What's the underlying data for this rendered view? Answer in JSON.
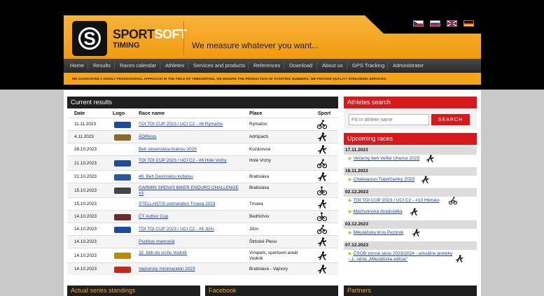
{
  "header": {
    "brand_main": "SPORT",
    "brand_soft": "SOFT",
    "brand_sub": "TIMING",
    "logo_letter": "S",
    "slogan": "We measure whatever you want..."
  },
  "flags": [
    "czech-flag-icon",
    "slovak-flag-icon",
    "uk-flag-icon",
    "german-flag-icon"
  ],
  "nav": [
    "Home",
    "Results",
    "Races calendar",
    "Athletes",
    "Services and products",
    "References",
    "Download",
    "About us",
    "GPS Tracking",
    "Administrator"
  ],
  "tagline": "WE GUARANTEE A HIGHLY PROFESSIONAL APPROACH IN THE FIELD OF TIMEKEEPING.    WE ENSURE THE PRODUCTION OF STARTING NUMBERS.    WE PROVIDE QUALITY STREAMING SERVICES.",
  "results": {
    "title": "Current results",
    "columns": [
      "Date",
      "Logo",
      "Race name",
      "Place",
      "Sport"
    ],
    "rows": [
      {
        "date": "11.11.2023",
        "name": "TOI TOI CUP 2023 / UCI C2 - #8 Rýmařov",
        "place": "Rýmařov",
        "sport": "cyclist-icon",
        "logo": "#1e4aa0"
      },
      {
        "date": "4.11.2023",
        "name": "ÁDRkros",
        "place": "Adršpach",
        "sport": "runner-icon",
        "logo": "#8a6a2a"
      },
      {
        "date": "28.10.2023",
        "name": "Beh slovenskou bránou 2023",
        "place": "Kozárovce",
        "sport": "runner-icon",
        "logo": ""
      },
      {
        "date": "21.10.2023",
        "name": "TOI TOI CUP 2023 / UCI C2 - #6 Holé Vrchy",
        "place": "Holé Vrchy",
        "sport": "cyclist-icon",
        "logo": "#1e4aa0"
      },
      {
        "date": "21.10.2023",
        "name": "48. Beh Devínskou kobylou",
        "place": "Bratislava",
        "sport": "runner-icon",
        "logo": "#2a5a9a"
      },
      {
        "date": "15.10.2023",
        "name": "GARMIN SPEN#3 BIKER ENDURO CHALLENGE #3",
        "place": "Bratislava",
        "sport": "bike-icon",
        "logo": "#444"
      },
      {
        "date": "15.10.2023",
        "name": "STELLANTIS polmaratón Trnava 2023",
        "place": "Trnava",
        "sport": "runner-icon",
        "logo": ""
      },
      {
        "date": "14.10.2023",
        "name": "ČT Author Cup",
        "place": "Bedřichov",
        "sport": "bike-icon",
        "logo": "#6a2a2a"
      },
      {
        "date": "14.10.2023",
        "name": "TOI TOI CUP 2023 / UCI C2 - #4 Jičín",
        "place": "Jičín",
        "sport": "cyclist-icon",
        "logo": "#1e4aa0"
      },
      {
        "date": "14.10.2023",
        "name": "Psoťkov memoriál",
        "place": "Štrbské Pleso",
        "sport": "runner-icon",
        "logo": ""
      },
      {
        "date": "14.10.2023",
        "name": "32. běh do vrchu Vodník",
        "place": "Vimperk, sportovní areál Vodník",
        "sport": "runner-icon",
        "logo": "#b88a10"
      },
      {
        "date": "14.10.2023",
        "name": "Vajnorský minimaratón 2023",
        "place": "Bratislava - Vajnory",
        "sport": "runner-icon",
        "logo": "#c8281a"
      }
    ]
  },
  "search": {
    "title": "Athletes search",
    "placeholder": "Fill in athlete name",
    "button": "SEARCH"
  },
  "upcoming": {
    "title": "Upcoming races",
    "groups": [
      {
        "date": "17.11.2023",
        "items": [
          {
            "name": "Večerný beh Veľké Uherce 2023",
            "sport": "runner-icon"
          }
        ]
      },
      {
        "date": "18.11.2023",
        "items": [
          {
            "name": "Chateaurun Topoľčianky 2023",
            "sport": "runner-icon"
          }
        ]
      },
      {
        "date": "02.12.2023",
        "items": [
          {
            "name": "TOI TOI CUP 2023 / UCI C2 - #10 Hlinsko",
            "sport": "cyclist-icon"
          },
          {
            "name": "Machulinská dvadsiatka",
            "sport": "runner-icon"
          }
        ]
      },
      {
        "date": "03.12.2023",
        "items": [
          {
            "name": "Mikulášsky kros Pezinok",
            "sport": "runner-icon"
          }
        ]
      },
      {
        "date": "07.12.2023",
        "items": [
          {
            "name": "ČSOB zimná séria 2023/2024 - virtuálne preteky - 1. séria „Mikulášska edícia\"",
            "sport": "runner-icon"
          }
        ]
      }
    ]
  },
  "bottom": [
    "Actual series standings",
    "Facebook",
    "Partners"
  ]
}
